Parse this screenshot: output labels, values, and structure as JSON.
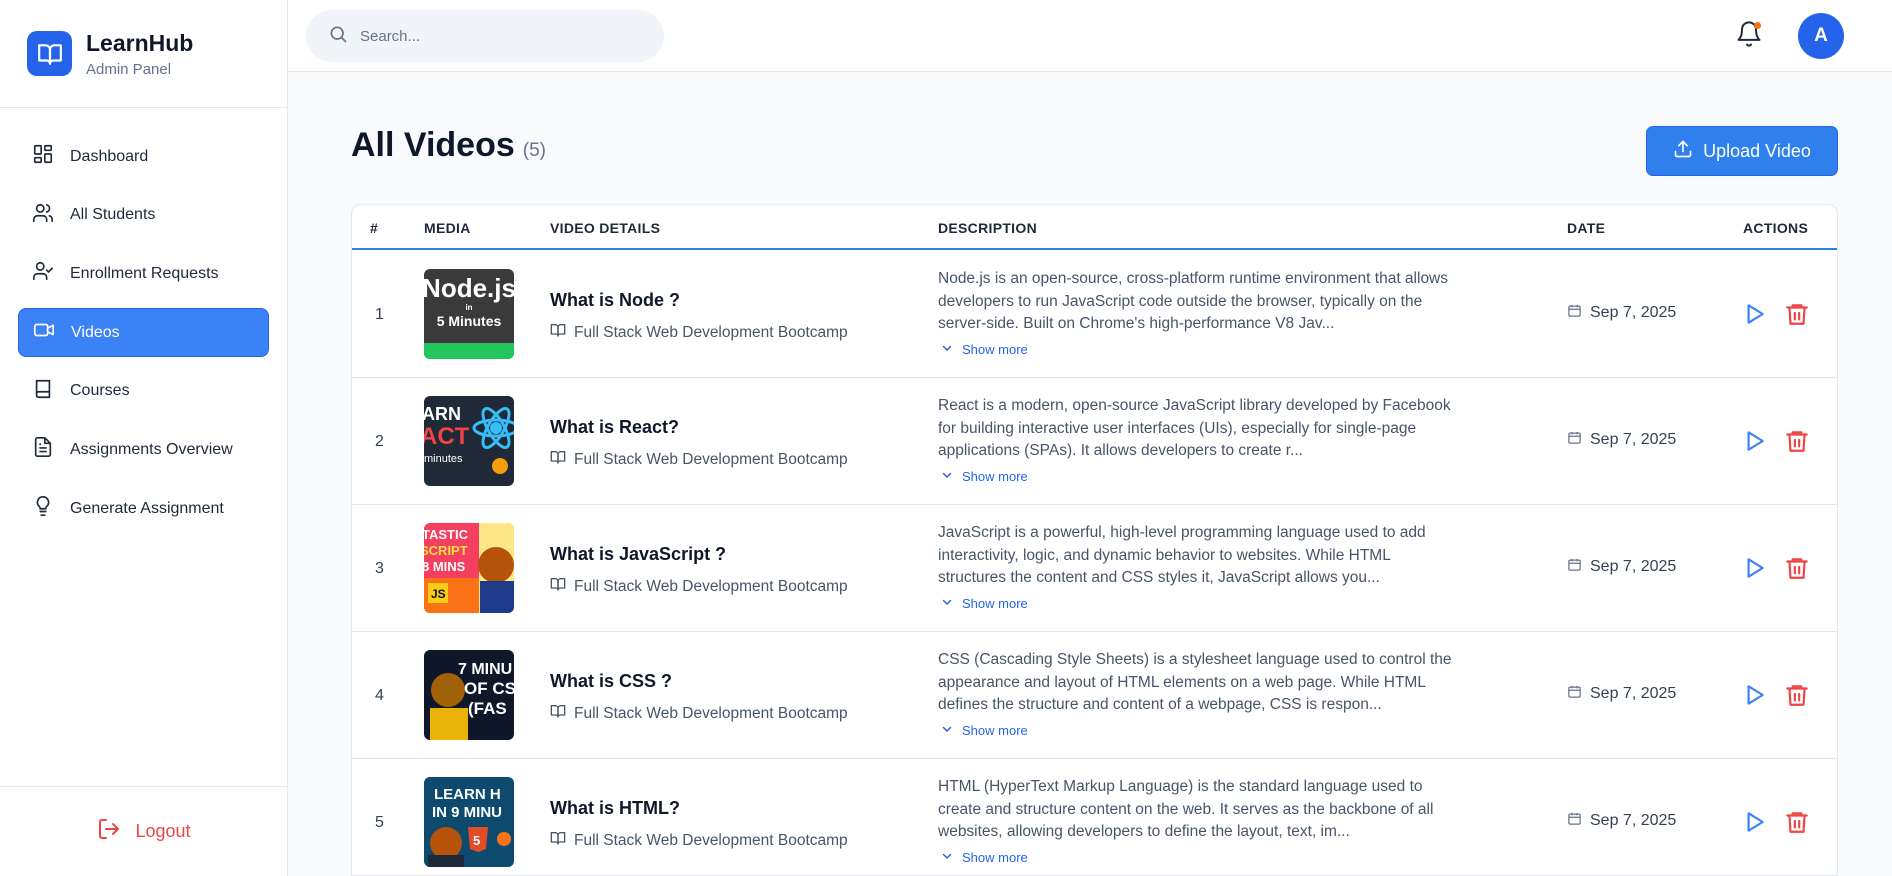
{
  "brand": {
    "name": "LearnHub",
    "subtitle": "Admin Panel"
  },
  "sidebar": {
    "items": [
      {
        "label": "Dashboard",
        "icon": "dashboard-grid-icon"
      },
      {
        "label": "All Students",
        "icon": "users-icon"
      },
      {
        "label": "Enrollment Requests",
        "icon": "user-check-icon"
      },
      {
        "label": "Videos",
        "icon": "video-icon",
        "active": true
      },
      {
        "label": "Courses",
        "icon": "book-icon"
      },
      {
        "label": "Assignments Overview",
        "icon": "file-text-icon"
      },
      {
        "label": "Generate Assignment",
        "icon": "lightbulb-icon"
      }
    ],
    "logout_label": "Logout"
  },
  "topbar": {
    "search_placeholder": "Search...",
    "avatar_initial": "A"
  },
  "page": {
    "title": "All Videos",
    "count": "(5)",
    "upload_label": "Upload Video"
  },
  "table": {
    "headers": {
      "num": "#",
      "media": "MEDIA",
      "details": "VIDEO DETAILS",
      "description": "DESCRIPTION",
      "date": "DATE",
      "actions": "ACTIONS"
    },
    "show_more_label": "Show more",
    "rows": [
      {
        "num": "1",
        "title": "What is Node ?",
        "course": "Full Stack Web Development Bootcamp",
        "description": "Node.js is an open-source, cross-platform runtime environment that allows developers to run JavaScript code outside the browser, typically on the server-side. Built on Chrome's high-performance V8 Jav...",
        "date": "Sep 7, 2025",
        "thumb_text": [
          "Node.js",
          "in",
          "5 Minutes"
        ]
      },
      {
        "num": "2",
        "title": "What is React?",
        "course": "Full Stack Web Development Bootcamp",
        "description": "React is a modern, open-source JavaScript library developed by Facebook for building interactive user interfaces (UIs), especially for single-page applications (SPAs). It allows developers to create r...",
        "date": "Sep 7, 2025",
        "thumb_text": [
          "ARN",
          "ACT",
          "minutes"
        ]
      },
      {
        "num": "3",
        "title": "What is JavaScript ?",
        "course": "Full Stack Web Development Bootcamp",
        "description": "JavaScript is a powerful, high-level programming language used to add interactivity, logic, and dynamic behavior to websites. While HTML structures the content and CSS styles it, JavaScript allows you...",
        "date": "Sep 7, 2025",
        "thumb_text": [
          "TASTIC",
          "SCRIPT",
          "8 MINS",
          "JS"
        ]
      },
      {
        "num": "4",
        "title": "What is CSS ?",
        "course": "Full Stack Web Development Bootcamp",
        "description": "CSS (Cascading Style Sheets) is a stylesheet language used to control the appearance and layout of HTML elements on a web page. While HTML defines the structure and content of a webpage, CSS is respon...",
        "date": "Sep 7, 2025",
        "thumb_text": [
          "7 MINU",
          "OF CS",
          "(FAS"
        ]
      },
      {
        "num": "5",
        "title": "What is HTML?",
        "course": "Full Stack Web Development Bootcamp",
        "description": "HTML (HyperText Markup Language) is the standard language used to create and structure content on the web. It serves as the backbone of all websites, allowing developers to define the layout, text, im...",
        "date": "Sep 7, 2025",
        "thumb_text": [
          "LEARN H",
          "IN 9 MINU",
          "5"
        ]
      }
    ]
  },
  "colors": {
    "accent": "#3b82f6",
    "danger": "#ef4444",
    "notification_dot": "#f97316"
  }
}
